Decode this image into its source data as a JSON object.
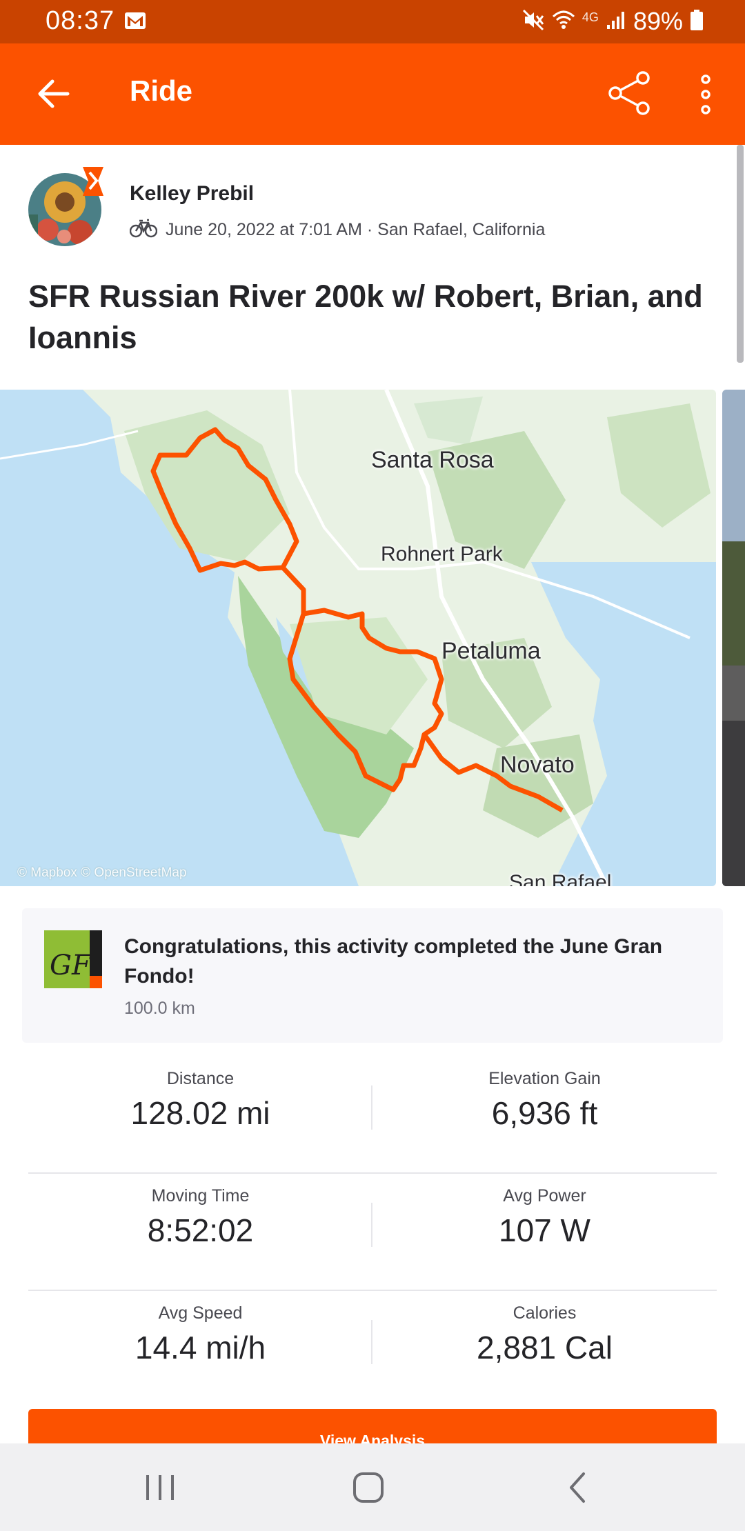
{
  "status_bar": {
    "time": "08:37",
    "network": "4G",
    "battery": "89%",
    "icons": [
      "gmail-icon",
      "mute-icon",
      "wifi-icon",
      "signal-icon",
      "battery-icon"
    ]
  },
  "app_bar": {
    "title": "Ride",
    "icons": [
      "back-arrow-icon",
      "share-icon",
      "more-vert-icon"
    ]
  },
  "activity": {
    "athlete_name": "Kelley Prebil",
    "sport_icon": "bicycle-icon",
    "date_location": "June 20, 2022 at 7:01 AM · San Rafael, California",
    "title": "SFR Russian River 200k w/ Robert, Brian, and Ioannis"
  },
  "map": {
    "labels": {
      "santa_rosa": "Santa Rosa",
      "rohnert_park": "Rohnert Park",
      "petaluma": "Petaluma",
      "novato": "Novato",
      "san_rafael": "San Rafael"
    },
    "attribution": "© Mapbox © OpenStreetMap",
    "route_color": "#fc5200",
    "water_color": "#bfe0f5",
    "land_color": "#e9f2e4"
  },
  "challenge": {
    "title": "Congratulations, this activity completed the June Gran Fondo!",
    "subtitle": "100.0 km",
    "badge_icon": "gran-fondo-badge-icon"
  },
  "stats": [
    {
      "left": {
        "label": "Distance",
        "value": "128.02 mi"
      },
      "right": {
        "label": "Elevation Gain",
        "value": "6,936 ft"
      }
    },
    {
      "left": {
        "label": "Moving Time",
        "value": "8:52:02"
      },
      "right": {
        "label": "Avg Power",
        "value": "107 W"
      }
    },
    {
      "left": {
        "label": "Avg Speed",
        "value": "14.4 mi/h"
      },
      "right": {
        "label": "Calories",
        "value": "2,881 Cal"
      }
    }
  ],
  "actions": {
    "view_analysis": "View Analysis"
  },
  "nav_bar": {
    "icons": [
      "recents-icon",
      "home-icon",
      "back-icon"
    ]
  },
  "colors": {
    "brand_orange": "#fc5200",
    "status_bar": "#c94300"
  }
}
